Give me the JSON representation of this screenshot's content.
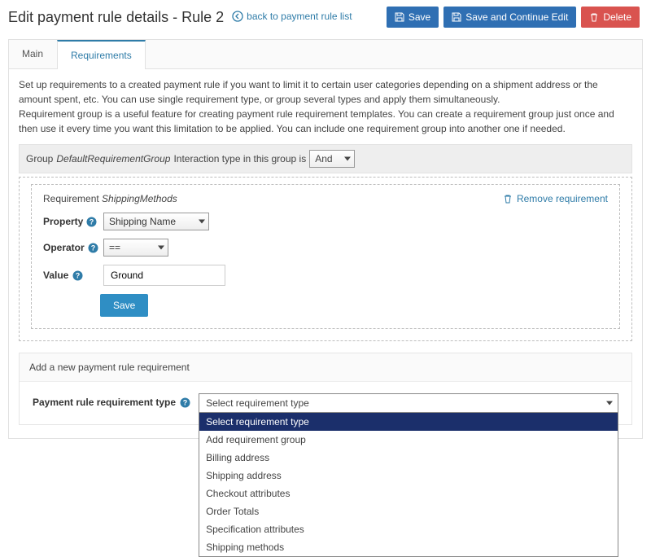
{
  "header": {
    "title": "Edit payment rule details - Rule 2",
    "back_link": "back to payment rule list",
    "save_label": "Save",
    "save_continue_label": "Save and Continue Edit",
    "delete_label": "Delete"
  },
  "tabs": {
    "main": "Main",
    "requirements": "Requirements"
  },
  "intro": {
    "p1": "Set up requirements to a created payment rule if you want to limit it to certain user categories depending on a shipment address or the amount spent, etc. You can use single requirement type, or group several types and apply them simultaneously.",
    "p2": "Requirement group is a useful feature for creating payment rule requirement templates. You can create a requirement group just once and then use it every time you want this limitation to be applied. You can include one requirement group into another one if needed."
  },
  "group_bar": {
    "prefix": "Group",
    "name": "DefaultRequirementGroup",
    "mid": "Interaction type in this group is",
    "select_value": "And"
  },
  "requirement": {
    "prefix": "Requirement",
    "name": "ShippingMethods",
    "remove_label": "Remove requirement",
    "property_label": "Property",
    "property_value": "Shipping Name",
    "operator_label": "Operator",
    "operator_value": "==",
    "value_label": "Value",
    "value_value": "Ground",
    "save_label": "Save"
  },
  "add_section": {
    "heading": "Add a new payment rule requirement",
    "label": "Payment rule requirement type",
    "selected": "Select requirement type",
    "options": [
      "Select requirement type",
      "Add requirement group",
      "Billing address",
      "Shipping address",
      "Checkout attributes",
      "Order Totals",
      "Specification attributes",
      "Shipping methods"
    ]
  }
}
